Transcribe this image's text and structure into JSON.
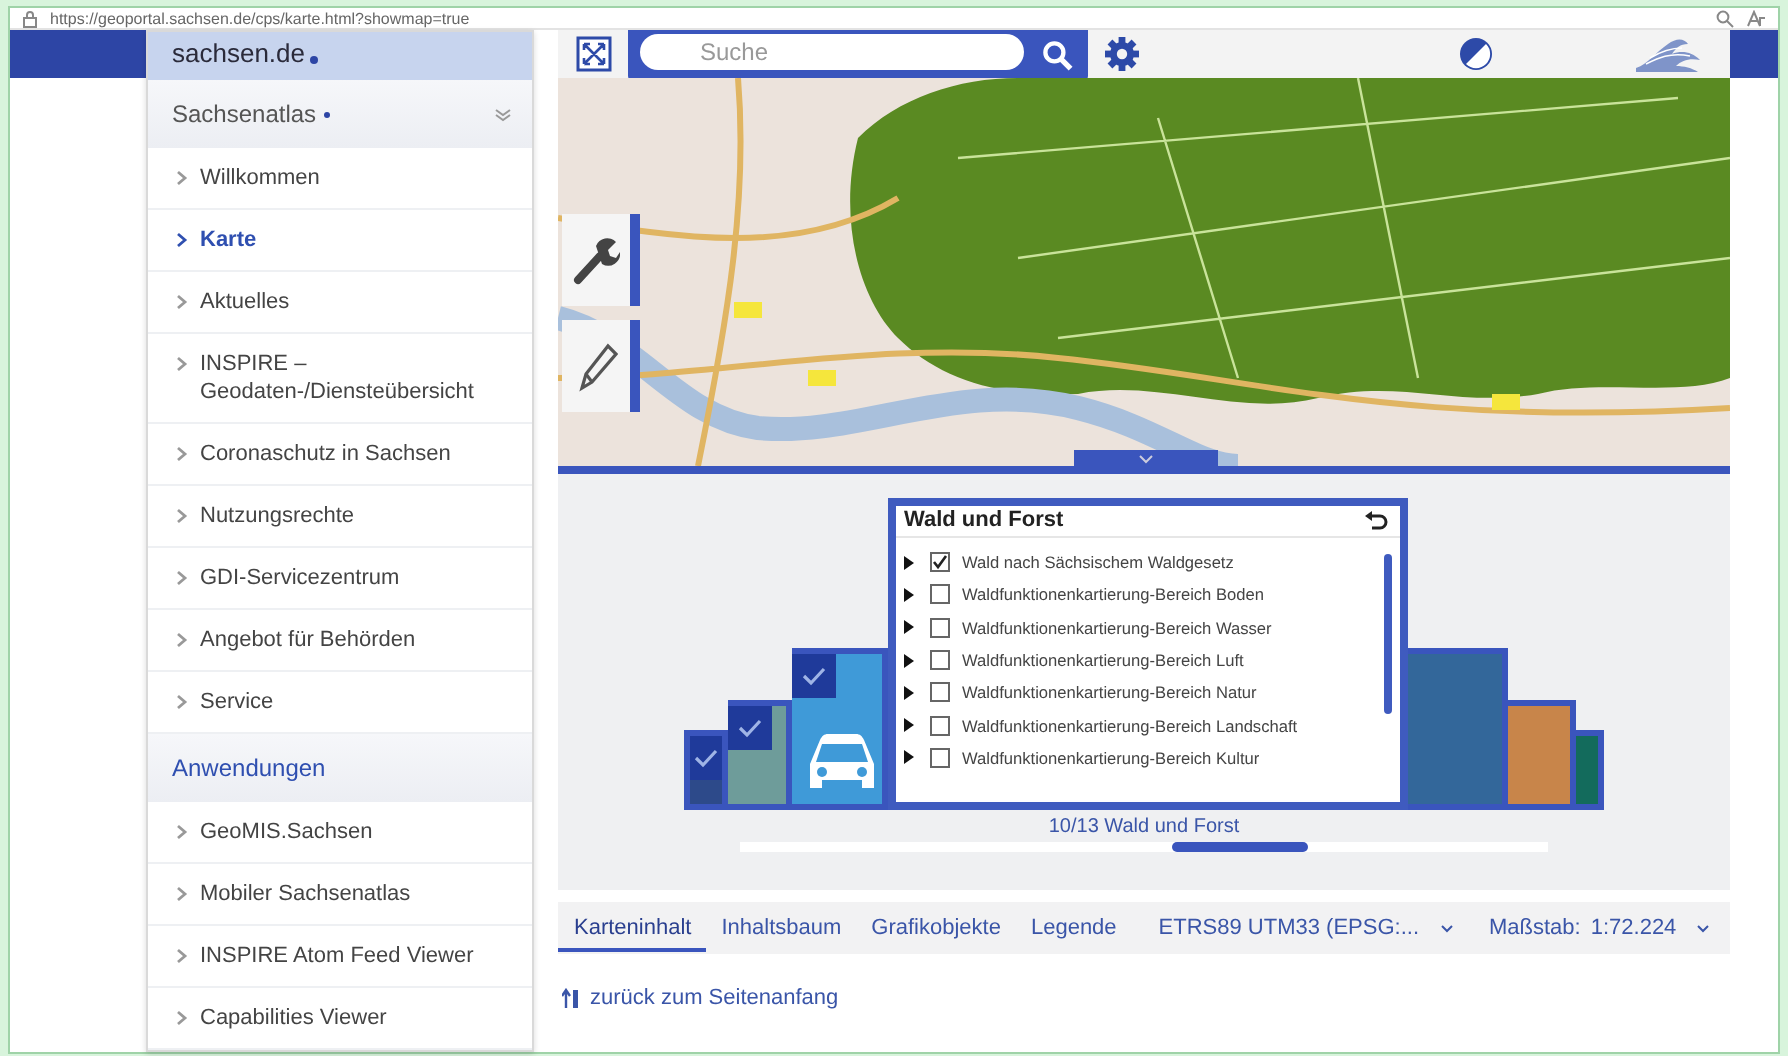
{
  "browser": {
    "url": "https://geoportal.sachsen.de/cps/karte.html?showmap=true"
  },
  "sidebar": {
    "brand": "sachsen.de",
    "sections": [
      {
        "title": "Sachsenatlas",
        "kind": "collapsible",
        "items": [
          {
            "label": "Willkommen",
            "selected": false
          },
          {
            "label": "Karte",
            "selected": true
          },
          {
            "label": "Aktuelles",
            "selected": false
          },
          {
            "label": "INSPIRE – Geodaten-/Diensteübersicht",
            "selected": false
          },
          {
            "label": "Coronaschutz in Sachsen",
            "selected": false
          },
          {
            "label": "Nutzungsrechte",
            "selected": false
          },
          {
            "label": "GDI-Servicezentrum",
            "selected": false
          },
          {
            "label": "Angebot für Behörden",
            "selected": false
          },
          {
            "label": "Service",
            "selected": false
          }
        ]
      },
      {
        "title": "Anwendungen",
        "kind": "heading",
        "items": [
          {
            "label": "GeoMIS.Sachsen",
            "selected": false
          },
          {
            "label": "Mobiler Sachsenatlas",
            "selected": false
          },
          {
            "label": "INSPIRE Atom Feed Viewer",
            "selected": false
          },
          {
            "label": "Capabilities Viewer",
            "selected": false
          }
        ]
      }
    ]
  },
  "header": {
    "search": {
      "placeholder": "Suche"
    }
  },
  "carousel": {
    "left_cards": [
      {
        "kind": "plain",
        "color": "#2d4a8a",
        "checked": true
      },
      {
        "kind": "plain",
        "color": "#6e9c9a",
        "checked": true
      },
      {
        "kind": "car",
        "color": "#3f9ad8",
        "checked": true
      }
    ],
    "popup": {
      "title": "Wald und Forst",
      "layers": [
        {
          "label": "Wald nach Sächsischem Waldgesetz",
          "checked": true
        },
        {
          "label": "Waldfunktionenkartierung-Bereich Boden",
          "checked": false
        },
        {
          "label": "Waldfunktionenkartierung-Bereich Wasser",
          "checked": false
        },
        {
          "label": "Waldfunktionenkartierung-Bereich Luft",
          "checked": false
        },
        {
          "label": "Waldfunktionenkartierung-Bereich Natur",
          "checked": false
        },
        {
          "label": "Waldfunktionenkartierung-Bereich Landschaft",
          "checked": false
        },
        {
          "label": "Waldfunktionenkartierung-Bereich Kultur",
          "checked": false
        }
      ]
    },
    "right_cards": [
      {
        "color": "#33679a"
      },
      {
        "color": "#c8854a"
      },
      {
        "color": "#136b5c"
      }
    ],
    "caption": "10/13 Wald und Forst"
  },
  "tabs": [
    {
      "label": "Karteninhalt",
      "selected": true
    },
    {
      "label": "Inhaltsbaum",
      "selected": false
    },
    {
      "label": "Grafikobjekte",
      "selected": false
    },
    {
      "label": "Legende",
      "selected": false
    }
  ],
  "crs": {
    "value": "ETRS89 UTM33 (EPSG:..."
  },
  "scale": {
    "label": "Maßstab:",
    "value": "1:72.224"
  },
  "back_link": "zurück zum Seitenanfang"
}
